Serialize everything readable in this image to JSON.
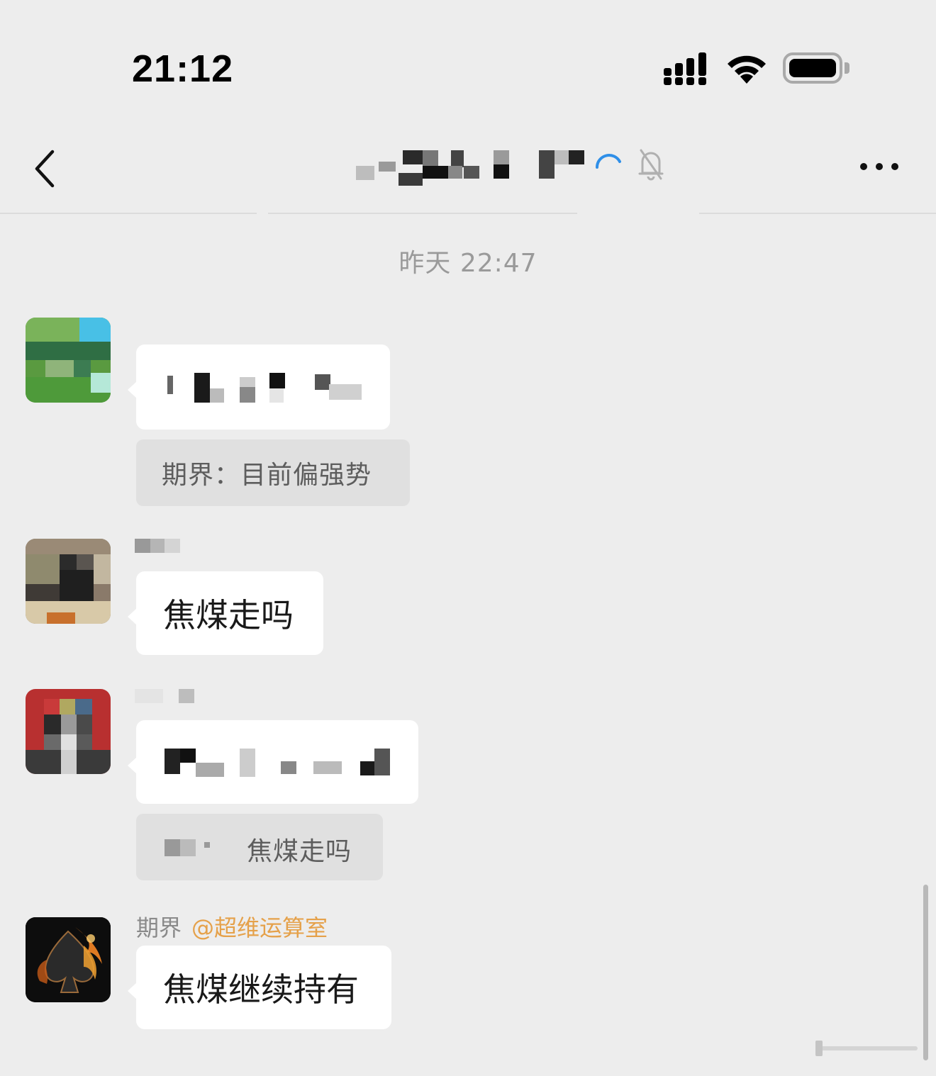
{
  "status_bar": {
    "time": "21:12",
    "signal_icon": "cellular-signal-icon",
    "wifi_icon": "wifi-icon",
    "battery_icon": "battery-icon"
  },
  "nav": {
    "back_icon": "chevron-left-icon",
    "loading_icon": "loading-spinner-icon",
    "mute_icon": "bell-muted-icon",
    "more_icon": "more-dots-icon"
  },
  "chat": {
    "timestamp": "昨天 22:47",
    "messages": [
      {
        "quote": "期界：目前偏强势"
      },
      {
        "text": "焦煤走吗"
      },
      {
        "quote_tail": "焦煤走吗"
      },
      {
        "sender": "期界",
        "mention": "@超维运算室",
        "text": "焦煤继续持有"
      }
    ]
  },
  "colors": {
    "background": "#ededed",
    "bubble": "#ffffff",
    "quote_bg": "#e0e0e0",
    "mention": "#e5a14a",
    "spinner": "#2f8fe8"
  }
}
